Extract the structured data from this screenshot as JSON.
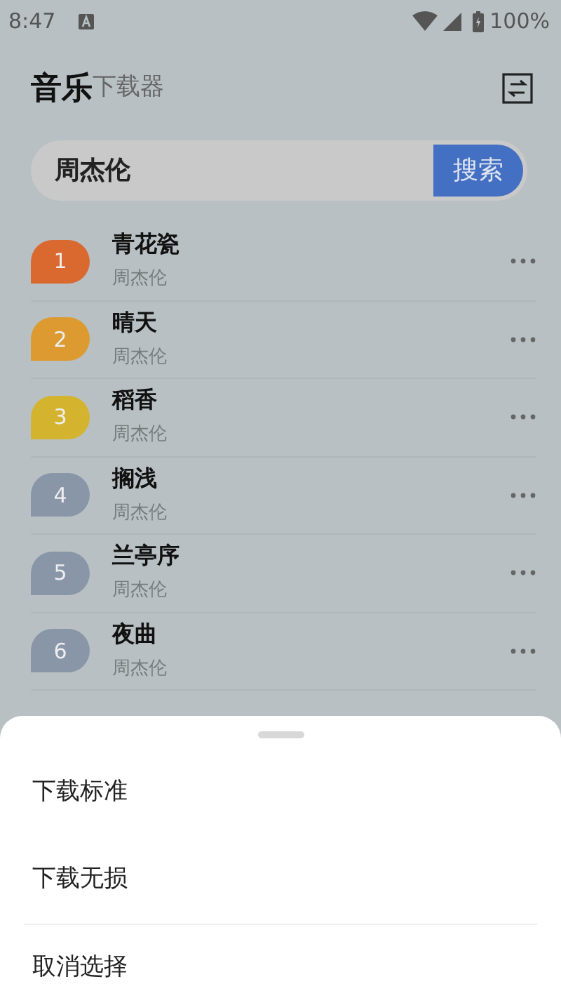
{
  "status_bar": {
    "time": "8:47",
    "battery": "100%"
  },
  "header": {
    "title": "音乐",
    "subtitle": "下载器"
  },
  "search": {
    "value": "周杰伦",
    "button": "搜索"
  },
  "songs": [
    {
      "rank": "1",
      "title": "青花瓷",
      "artist": "周杰伦",
      "color": "#d9692e"
    },
    {
      "rank": "2",
      "title": "晴天",
      "artist": "周杰伦",
      "color": "#dc9a30"
    },
    {
      "rank": "3",
      "title": "稻香",
      "artist": "周杰伦",
      "color": "#d4b42e"
    },
    {
      "rank": "4",
      "title": "搁浅",
      "artist": "周杰伦",
      "color": "#8896a7"
    },
    {
      "rank": "5",
      "title": "兰亭序",
      "artist": "周杰伦",
      "color": "#8896a7"
    },
    {
      "rank": "6",
      "title": "夜曲",
      "artist": "周杰伦",
      "color": "#8896a7"
    }
  ],
  "sheet": {
    "options": [
      "下载标准",
      "下载无损",
      "取消选择"
    ]
  }
}
